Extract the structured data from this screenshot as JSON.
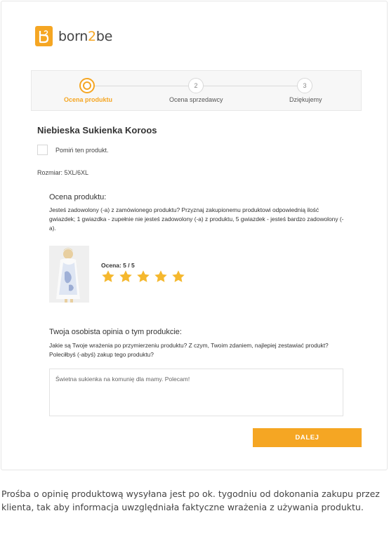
{
  "logo": {
    "icon": "b2-logo-mark",
    "text_left": "born",
    "text_mid": "2",
    "text_right": "be",
    "brand_color": "#f5a623"
  },
  "stepper": {
    "steps": [
      {
        "number": "",
        "label": "Ocena produktu",
        "active": true
      },
      {
        "number": "2",
        "label": "Ocena sprzedawcy",
        "active": false
      },
      {
        "number": "3",
        "label": "Dziękujemy",
        "active": false
      }
    ]
  },
  "product": {
    "title": "Niebieska Sukienka Koroos",
    "skip_label": "Pomiń ten produkt.",
    "size": "Rozmiar: 5XL/6XL"
  },
  "rating_section": {
    "title": "Ocena produktu:",
    "description": "Jesteś zadowolony (-a) z zamówionego produktu? Przyznaj zakupionemu produktowi odpowiednią ilość gwiazdek; 1 gwiazdka - zupełnie nie jesteś zadowolony (-a) z produktu, 5 gwiazdek - jesteś bardzo zadowolony (-a).",
    "rating_label": "Ocena: 5 / 5",
    "rating_value": 5,
    "rating_max": 5,
    "star_color": "#f5b82e"
  },
  "opinion_section": {
    "title": "Twoja osobista opinia o tym produkcie:",
    "description": "Jakie są Twoje wrażenia po przymierzeniu produktu? Z czym, Twoim zdaniem, najlepiej zestawiać produkt? Poleciłbyś (-abyś) zakup tego produktu?",
    "value": "Świetna sukienka na komunię dla mamy. Polecam!"
  },
  "actions": {
    "next_label": "DALEJ"
  },
  "caption": "Prośba o opinię produktową wysyłana jest po ok. tygodniu od dokonania zakupu przez klienta, tak aby informacja uwzględniała faktyczne wrażenia z używania produktu."
}
